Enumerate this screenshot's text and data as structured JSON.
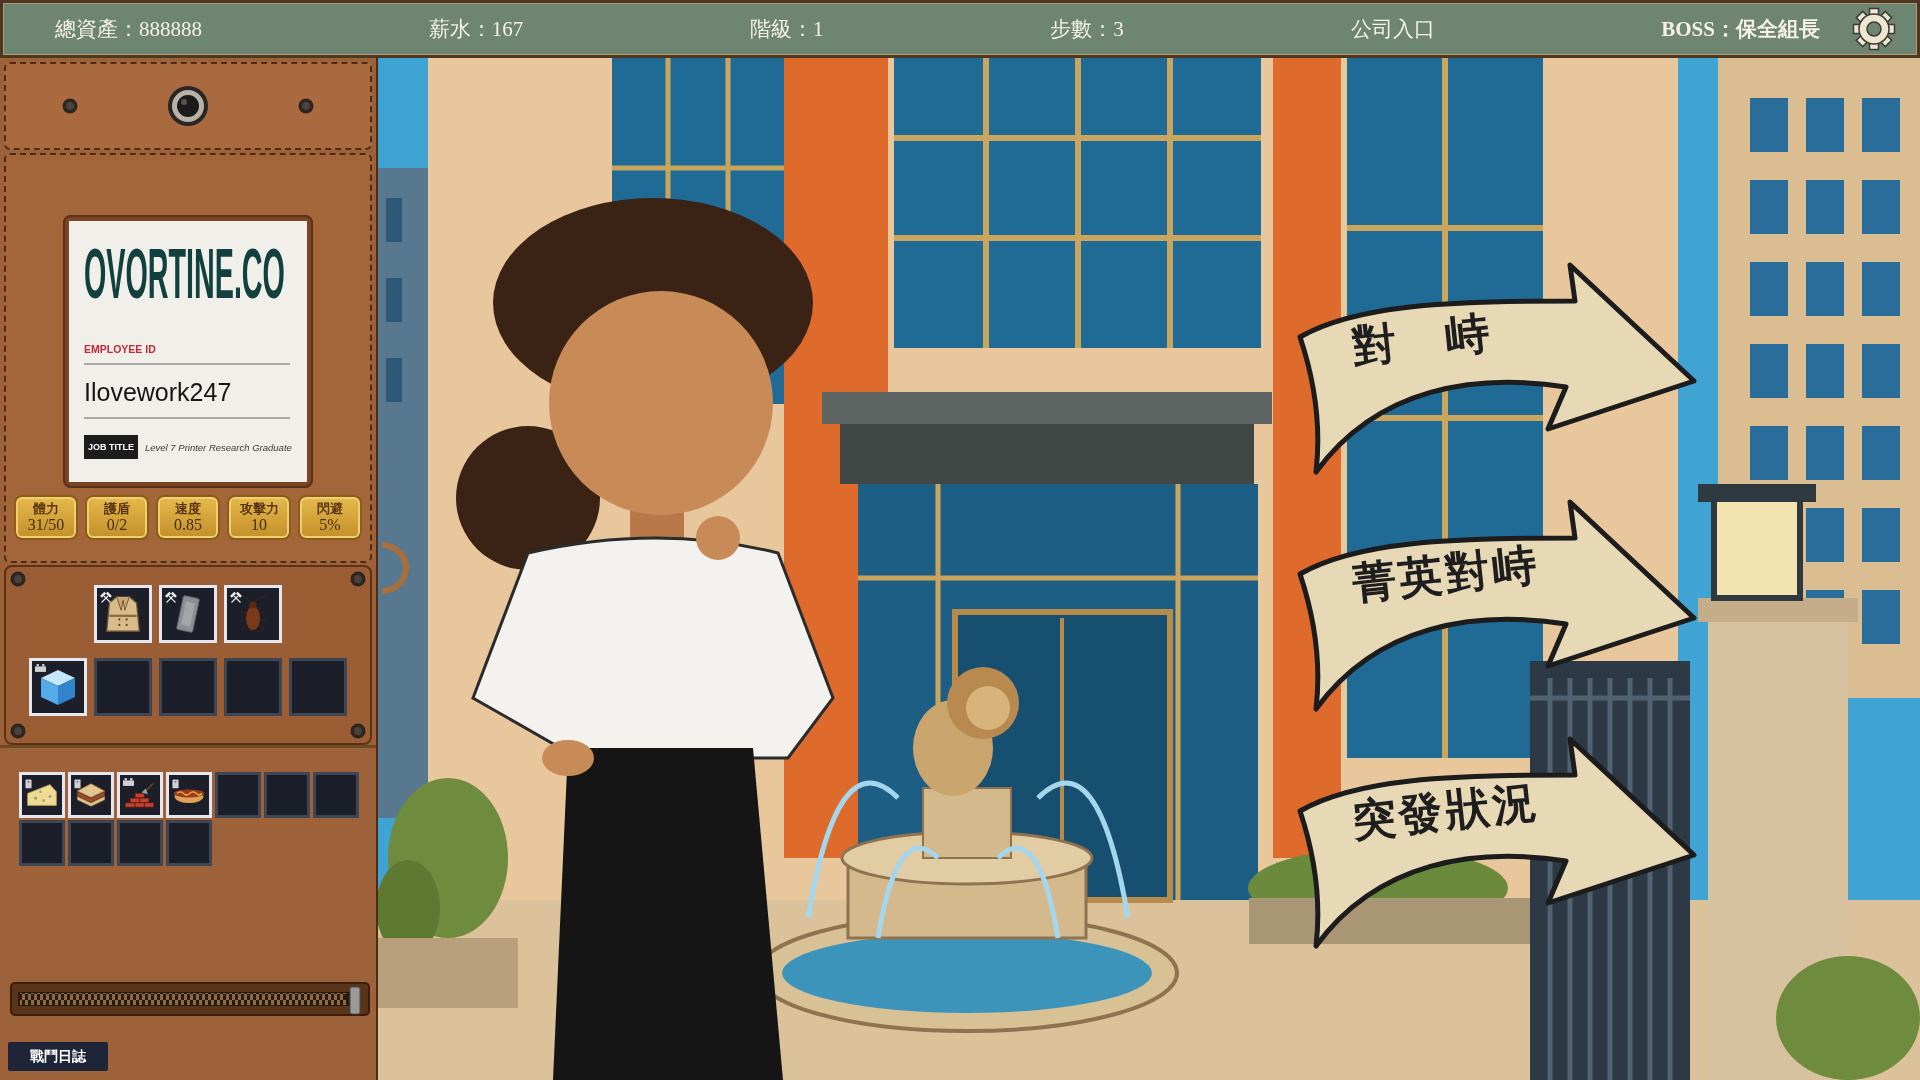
{
  "top_bar": {
    "items": [
      {
        "text": "總資產：888888",
        "emphasis": false
      },
      {
        "text": "薪水：167",
        "emphasis": false
      },
      {
        "text": "階級：1",
        "emphasis": false
      },
      {
        "text": "步數：3",
        "emphasis": false
      },
      {
        "text": "公司入口",
        "emphasis": false
      },
      {
        "text": "BOSS：保全組長",
        "emphasis": true
      }
    ]
  },
  "left_panel": {
    "id_card": {
      "company": "OVORTINE.CO",
      "id_label": "EMPLOYEE ID",
      "employee_id": "Ilovework247",
      "title_label": "JOB TITLE",
      "job_title": "Level 7 Printer Research Graduate"
    },
    "stats": [
      {
        "label": "體力",
        "value": "31/50"
      },
      {
        "label": "護盾",
        "value": "0/2"
      },
      {
        "label": "速度",
        "value": "0.85"
      },
      {
        "label": "攻擊力",
        "value": "10"
      },
      {
        "label": "閃避",
        "value": "5%"
      }
    ],
    "equipment": [
      {
        "slots": [
          {
            "kind": "coat",
            "marker": {
              "kind": "tools"
            }
          },
          {
            "kind": "slab",
            "marker": {
              "kind": "tools"
            }
          },
          {
            "kind": "cockroach",
            "marker": {
              "kind": "tools"
            }
          }
        ]
      },
      {
        "slots": [
          {
            "kind": "ice_cube",
            "marker": {
              "kind": "battery"
            }
          },
          {
            "kind": "empty"
          },
          {
            "kind": "empty"
          },
          {
            "kind": "empty"
          },
          {
            "kind": "empty"
          }
        ]
      }
    ],
    "backpack": {
      "slots": [
        {
          "kind": "cheese",
          "marker": {
            "kind": "tag"
          }
        },
        {
          "kind": "sandwich",
          "marker": {
            "kind": "tag"
          }
        },
        {
          "kind": "bricks",
          "marker": {
            "kind": "battery"
          }
        },
        {
          "kind": "hot_dog",
          "marker": {
            "kind": "tag"
          }
        },
        {
          "kind": "empty"
        },
        {
          "kind": "empty"
        },
        {
          "kind": "empty"
        },
        {
          "kind": "empty"
        },
        {
          "kind": "empty"
        },
        {
          "kind": "empty"
        },
        {
          "kind": "empty"
        }
      ]
    },
    "log_button": "戰鬥日誌"
  },
  "scene": {
    "choices": [
      {
        "label": "對　峙"
      },
      {
        "label": "菁英對峙"
      },
      {
        "label": "突發狀況"
      }
    ]
  }
}
